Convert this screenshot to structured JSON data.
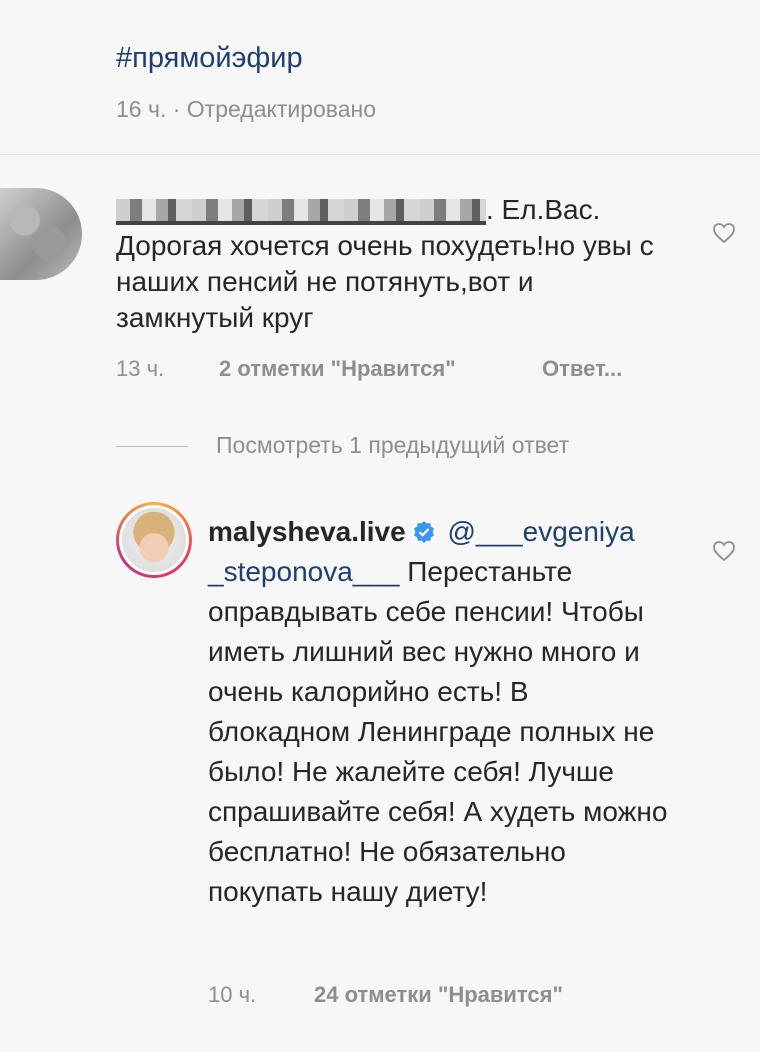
{
  "post": {
    "hashtag": "#прямойэфир",
    "meta": "16 ч. · Отредактировано"
  },
  "comment1": {
    "text_suffix": ". Ел.Вас. Дорогая хочется очень похудеть!но увы с наших пенсий не потянуть,вот и замкнутый круг",
    "time": "13 ч.",
    "likes": "2 отметки \"Нравится\"",
    "reply": "Ответ..."
  },
  "view_previous": "Посмотреть 1 предыдущий ответ",
  "comment2": {
    "username": "malysheva.live",
    "mention": "@___evgeniya _steponova___",
    "text": "Перестаньте оправдывать себе пенсии! Чтобы иметь лишний вес нужно много и очень калорийно есть! В блокадном Ленинграде полных не было! Не жалейте себя! Лучше спрашивайте себя! А худеть можно бесплатно! Не обязательно покупать нашу диету!",
    "time": "10 ч.",
    "likes": "24 отметки \"Нравится\""
  },
  "icons": {
    "like": "heart-outline-icon",
    "verified": "verified-badge-icon"
  },
  "colors": {
    "link": "#1f3f6e",
    "muted": "#8e8e8e",
    "verified": "#3897f0"
  }
}
